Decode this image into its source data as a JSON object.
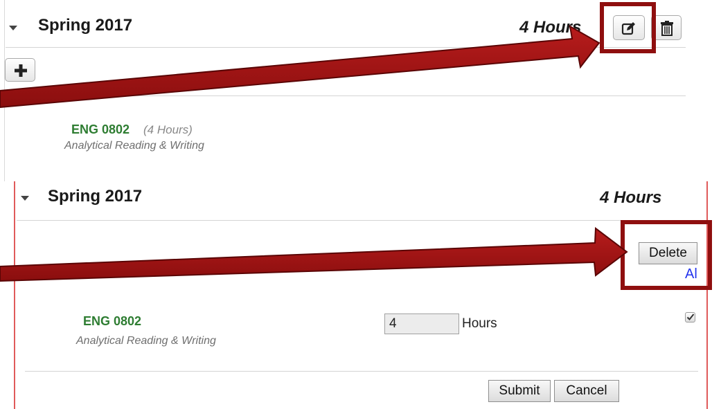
{
  "top_panel": {
    "term_title": "Spring 2017",
    "hours_total": "4 Hours",
    "edit_icon": "edit-icon",
    "trash_icon": "trash-icon",
    "add_icon": "plus-icon",
    "course": {
      "code": "ENG 0802",
      "hours": "(4 Hours)",
      "name": "Analytical Reading & Writing"
    }
  },
  "edit_panel": {
    "term_title": "Spring 2017",
    "hours_total": "4 Hours",
    "delete_label": "Delete",
    "partial_link": "Al",
    "course": {
      "code": "ENG 0802",
      "name": "Analytical Reading & Writing",
      "hours_value": "4",
      "hours_label": "Hours",
      "checked": true
    },
    "submit_label": "Submit",
    "cancel_label": "Cancel"
  },
  "annotation_color": "#9b1111"
}
